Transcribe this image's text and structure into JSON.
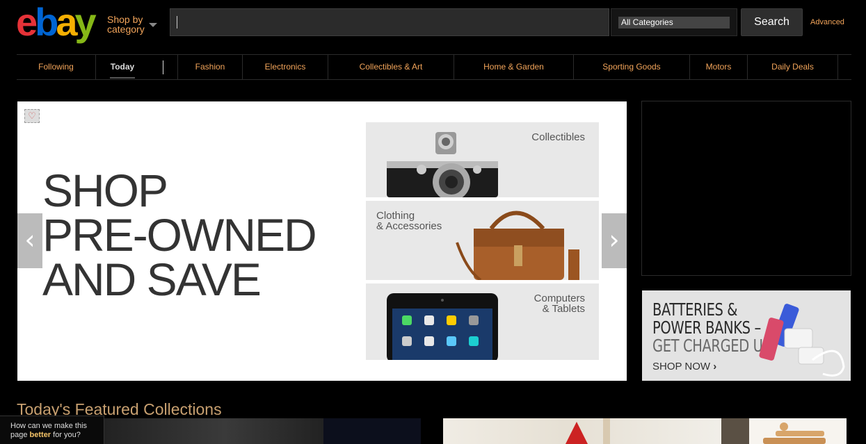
{
  "header": {
    "logo_letters": [
      "e",
      "b",
      "a",
      "y"
    ],
    "shop_by": "Shop by",
    "shop_category": "category",
    "search_placeholder": "",
    "category_selected": "All Categories",
    "search_button": "Search",
    "advanced_link": "Advanced"
  },
  "nav": {
    "items": [
      {
        "label": "Following"
      },
      {
        "label": "Today"
      },
      {
        "label": "Fashion"
      },
      {
        "label": "Electronics"
      },
      {
        "label": "Collectibles & Art"
      },
      {
        "label": "Home & Garden"
      },
      {
        "label": "Sporting Goods"
      },
      {
        "label": "Motors"
      },
      {
        "label": "Daily Deals"
      }
    ],
    "active": "Today"
  },
  "hero": {
    "headline": [
      "SHOP",
      "PRE-OWNED",
      "AND SAVE"
    ],
    "tiles": [
      {
        "label_lines": [
          "Collectibles"
        ],
        "icon": "camera-image"
      },
      {
        "label_lines": [
          "Clothing",
          "& Accessories"
        ],
        "icon": "handbag-image"
      },
      {
        "label_lines": [
          "Computers",
          "& Tablets"
        ],
        "icon": "tablet-image"
      }
    ],
    "prev_arrow": "‹",
    "next_arrow": "›",
    "heart_icon": "♡"
  },
  "promo": {
    "line1": "BATTERIES &",
    "line2": "POWER BANKS –",
    "line3": "GET CHARGED UP",
    "cta": "SHOP NOW",
    "cta_arrow": "›"
  },
  "featured": {
    "title": "Today's Featured Collections"
  },
  "feedback": {
    "line1": "How can we make this",
    "line2_pre": "page ",
    "line2_bold": "better",
    "line2_post": " for you?"
  },
  "colors": {
    "accent": "#f2a45a",
    "background": "#000000"
  }
}
